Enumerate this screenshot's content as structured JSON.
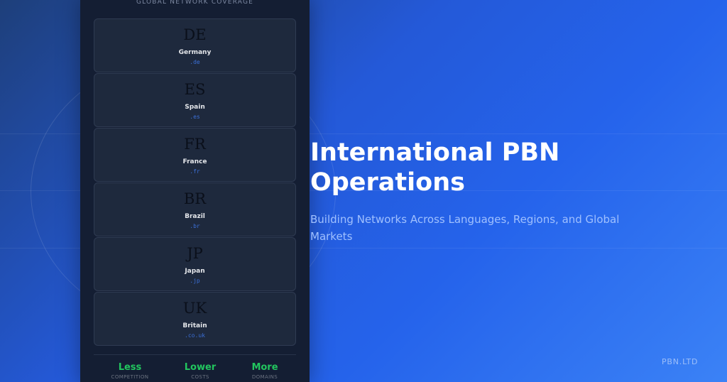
{
  "panel": {
    "title": "GLOBAL NETWORK COVERAGE",
    "countries": [
      {
        "code": "DE",
        "name": "Germany",
        "tld": ".de"
      },
      {
        "code": "ES",
        "name": "Spain",
        "tld": ".es"
      },
      {
        "code": "FR",
        "name": "France",
        "tld": ".fr"
      },
      {
        "code": "BR",
        "name": "Brazil",
        "tld": ".br"
      },
      {
        "code": "JP",
        "name": "Japan",
        "tld": ".jp"
      },
      {
        "code": "UK",
        "name": "Britain",
        "tld": ".co.uk"
      }
    ],
    "stats": [
      {
        "value": "Less",
        "label": "COMPETITION"
      },
      {
        "value": "Lower",
        "label": "COSTS"
      },
      {
        "value": "More",
        "label": "DOMAINS"
      }
    ]
  },
  "hero": {
    "title": "International PBN Operations",
    "subtitle": "Building Networks Across Languages, Regions, and Global Markets"
  },
  "brand": "PBN.LTD",
  "colors": {
    "accent_green": "#22c55e",
    "tld_blue": "#3b6fd6",
    "panel_bg": "#141e33"
  }
}
